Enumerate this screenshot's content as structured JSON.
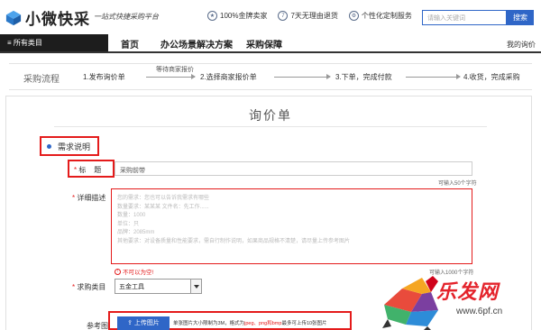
{
  "header": {
    "brand": "小微快采",
    "slogan": "一站式快捷采购平台",
    "badges": [
      {
        "icon": "shield-icon",
        "label": "100%金牌卖家"
      },
      {
        "icon": "seven-days-icon",
        "label": "7天无理由退货"
      },
      {
        "icon": "gear-icon",
        "label": "个性化定制服务"
      }
    ],
    "search_placeholder": "请输入关键词",
    "search_button": "搜索"
  },
  "nav": {
    "all_categories": "所有类目",
    "items": [
      "首页",
      "办公场景解决方案",
      "采购保障"
    ],
    "my_inquiry": "我的询价"
  },
  "process": {
    "title": "采购流程",
    "steps": [
      "1.发布询价单",
      "2.选择商家报价单",
      "3.下单，完成付款",
      "4.收货，完成采购"
    ],
    "waiting_label": "等待商家报价"
  },
  "form": {
    "title": "询价单",
    "section": "需求说明",
    "title_label": "标    题",
    "title_value": "采购前带",
    "title_hint": "可输入50个字符",
    "detail_label": "详细描述",
    "detail_placeholder": [
      "您的需求：您也可以告诉我需求有哪些",
      "数量要求：某某某  文件名：先工作......",
      "数量：1000",
      "单位：只",
      "品牌：2085mm",
      "其他要求：对设备质量和性能要求，需自行制作说明，如果商品规格不清楚，请尽量上传参考图片"
    ],
    "detail_hint": "可输入1000个字符",
    "error": "不可以为空!",
    "category_label": "求购类目",
    "category_value": "五金工具",
    "reference_label": "参考图",
    "upload_button": "上传图片",
    "upload_tip_prefix": "单张图片大小限制为3M，格式为",
    "upload_tip_formats": "jpeg、png和bmp",
    "upload_tip_suffix": "最多可上传10张图片"
  },
  "watermark": {
    "text": "乐发网",
    "url": "www.6pf.cn"
  },
  "colors": {
    "accent": "#2f66c7",
    "highlight": "#e41b1b",
    "nav_dark": "#1d1d1d"
  }
}
